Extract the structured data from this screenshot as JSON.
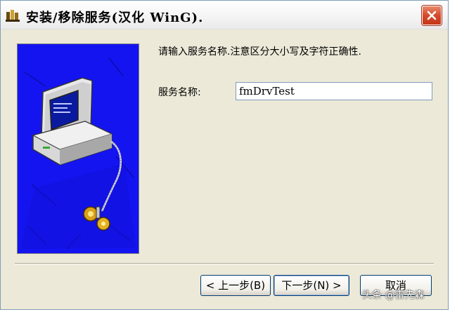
{
  "window": {
    "title": "安装/移除服务(汉化 WinG).",
    "close_label": "×"
  },
  "content": {
    "instruction": "请输入服务名称.注意区分大小写及字符正确性.",
    "service_name_label": "服务名称:",
    "service_name_value": "fmDrvTest"
  },
  "buttons": {
    "back": "< 上一步(B)",
    "next": "下一步(N) >",
    "cancel": "取消"
  },
  "watermark": "头条 @雷先森",
  "colors": {
    "dialog_bg": "#ece9d8",
    "wizard_image_bg": "#1414f0",
    "close_button": "#d44a2a"
  }
}
